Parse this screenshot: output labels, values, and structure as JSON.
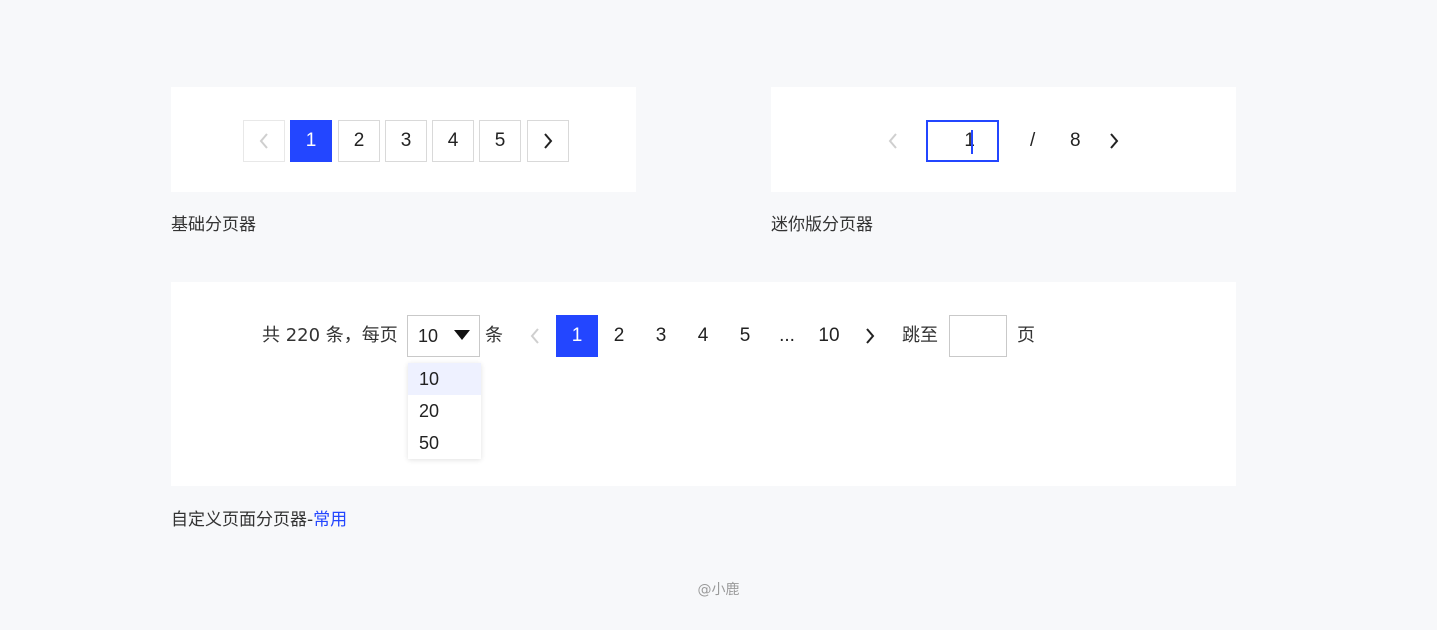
{
  "basic": {
    "caption": "基础分页器",
    "pages": [
      "1",
      "2",
      "3",
      "4",
      "5"
    ],
    "current": "1"
  },
  "mini": {
    "caption": "迷你版分页器",
    "current": "1",
    "separator": "/",
    "total": "8"
  },
  "full": {
    "caption_main": "自定义页面分页器-",
    "caption_tag": "常用",
    "total_label": "共 220 条，每页",
    "page_size": "10",
    "size_unit": "条",
    "pages": [
      "1",
      "2",
      "3",
      "4",
      "5",
      "...",
      "10"
    ],
    "jump_label": "跳至",
    "jump_unit": "页",
    "jump_value": "",
    "size_options": [
      "10",
      "20",
      "50"
    ]
  },
  "footer": {
    "credit": "@小鹿"
  },
  "colors": {
    "accent": "#2346ff",
    "border": "#d9d9d9",
    "background": "#f7f8fa"
  }
}
